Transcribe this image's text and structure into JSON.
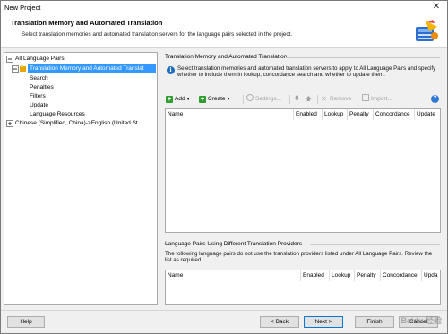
{
  "window": {
    "title": "New Project",
    "close_glyph": "✕"
  },
  "header": {
    "title": "Translation Memory and Automated Translation",
    "subtitle": "Select translation memories and automated translation servers for the language pairs selected in the project.",
    "icon": "tm-icon"
  },
  "tree": {
    "items": [
      {
        "label": "All Language Pairs"
      },
      {
        "label": "Translation Memory and Automated Translat"
      },
      {
        "label": "Search"
      },
      {
        "label": "Penalties"
      },
      {
        "label": "Filters"
      },
      {
        "label": "Update"
      },
      {
        "label": "Language Resources"
      },
      {
        "label": "Chinese (Simplified, China)->English (United St"
      }
    ]
  },
  "main": {
    "section1_title": "Translation Memory and Automated Translation",
    "section1_desc": "Select translation memories and automated translation servers to apply to All Language Pairs and specify whether to include them in lookup, concordance search and whether to update them.",
    "toolbar": {
      "add": "Add",
      "create": "Create",
      "settings": "Settings...",
      "remove": "Remove",
      "import": "Import...",
      "help": "?"
    },
    "grid1_columns": [
      "Name",
      "Enabled",
      "Lookup",
      "Penalty",
      "Concordance",
      "Update"
    ],
    "section2_title": "Language Pairs Using Different Translation Providers",
    "section2_desc": "The following language pairs do not use the translation providers listed under All Language Pairs. Review the list as required.",
    "grid2_columns": [
      "Name",
      "Enabled",
      "Lookup",
      "Penalty",
      "Concordance",
      "Upda"
    ]
  },
  "footer": {
    "help": "Help",
    "back": "< Back",
    "next": "Next >",
    "finish": "Finish",
    "cancel": "Cancel"
  },
  "watermark": "Baidu 经验",
  "colors": {
    "selection": "#3399ff",
    "default_button_border": "#0078d7",
    "plus_green": "#2e9d2e"
  }
}
